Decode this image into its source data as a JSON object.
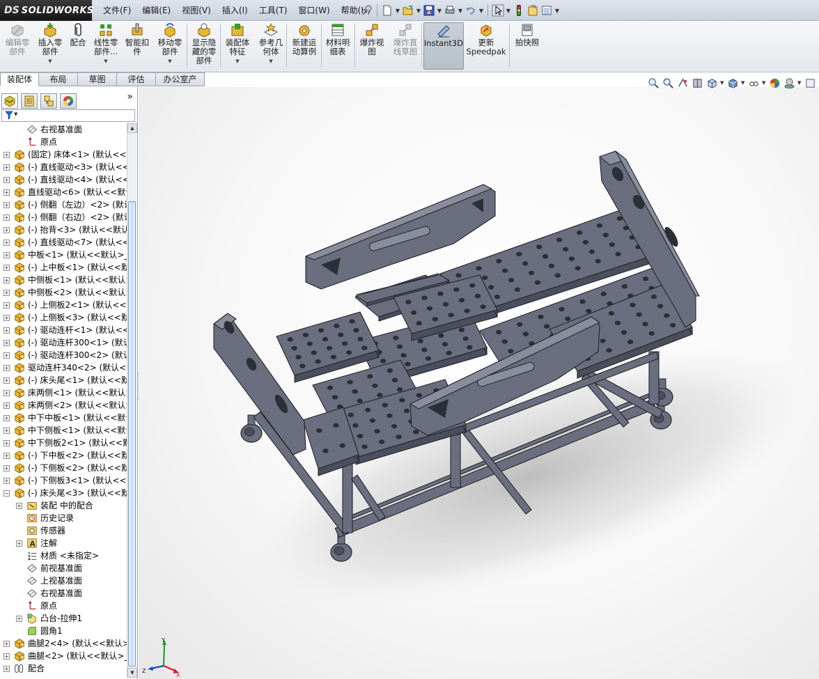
{
  "app": {
    "logo_prefix": "DS",
    "brand": "SOLIDWORKS"
  },
  "menu": [
    "文件(F)",
    "编辑(E)",
    "视图(V)",
    "插入(I)",
    "工具(T)",
    "窗口(W)",
    "帮助(H)"
  ],
  "quick_icons": [
    "pin-icon",
    "new-document-icon",
    "open-icon",
    "save-icon",
    "print-icon",
    "undo-icon",
    "select-cursor-icon",
    "rebuild-icon",
    "file-properties-icon",
    "options-icon"
  ],
  "commands": [
    {
      "label": "编辑零\n部件",
      "icon": "edit-component-icon",
      "disabled": true,
      "dropdown": false
    },
    {
      "label": "插入零\n部件",
      "icon": "insert-component-icon",
      "disabled": false,
      "dropdown": true
    },
    {
      "label": "配合",
      "icon": "mate-paperclip-icon",
      "disabled": false,
      "dropdown": false
    },
    {
      "label": "线性零\n部件...",
      "icon": "linear-pattern-icon",
      "disabled": false,
      "dropdown": true
    },
    {
      "label": "智能扣\n件",
      "icon": "smart-fasteners-icon",
      "disabled": false,
      "dropdown": false
    },
    {
      "label": "移动零\n部件",
      "icon": "move-component-icon",
      "disabled": false,
      "dropdown": true
    },
    {
      "label": "显示隐\n藏的零\n部件",
      "icon": "show-hidden-icon",
      "disabled": false,
      "dropdown": false
    },
    {
      "label": "装配体\n特征",
      "icon": "assembly-feature-icon",
      "disabled": false,
      "dropdown": true
    },
    {
      "label": "参考几\n何体",
      "icon": "reference-geometry-icon",
      "disabled": false,
      "dropdown": true
    },
    {
      "label": "新建运\n动算例",
      "icon": "new-motion-study-icon",
      "disabled": false,
      "dropdown": false
    },
    {
      "label": "材料明\n细表",
      "icon": "bill-of-materials-icon",
      "disabled": false,
      "dropdown": false
    },
    {
      "label": "爆炸视\n图",
      "icon": "exploded-view-icon",
      "disabled": false,
      "dropdown": false
    },
    {
      "label": "爆炸直\n线草图",
      "icon": "explode-line-sketch-icon",
      "disabled": true,
      "dropdown": false
    },
    {
      "label": "Instant3D",
      "icon": "instant3d-icon",
      "disabled": false,
      "dropdown": false,
      "active": true
    },
    {
      "label": "更新\nSpeedpak",
      "icon": "speedpak-icon",
      "disabled": false,
      "dropdown": false
    },
    {
      "label": "拍快照",
      "icon": "snapshot-icon",
      "disabled": false,
      "dropdown": false
    }
  ],
  "tabs": [
    "装配体",
    "布局",
    "草图",
    "评估",
    "办公室产品"
  ],
  "active_tab": "装配体",
  "panel_tabs": [
    "featuremanager-icon",
    "propertymanager-icon",
    "configurationmanager-icon",
    "appearance-icon"
  ],
  "panel_expand_glyph": "»",
  "filter_glyph": "▼",
  "tree": [
    {
      "label": "右视基准面",
      "icon": "plane-icon",
      "level": 1,
      "expander": ""
    },
    {
      "label": "原点",
      "icon": "origin-icon",
      "level": 1,
      "expander": ""
    },
    {
      "label": "(固定) 床体<1> (默认<<默",
      "icon": "part-icon",
      "level": 0,
      "expander": "+"
    },
    {
      "label": "(-) 直线驱动<3> (默认<<",
      "icon": "part-icon",
      "level": 0,
      "expander": "+"
    },
    {
      "label": "(-) 直线驱动<4> (默认<<",
      "icon": "part-icon",
      "level": 0,
      "expander": "+"
    },
    {
      "label": "直线驱动<6> (默认<<默认",
      "icon": "part-icon",
      "level": 0,
      "expander": "+"
    },
    {
      "label": "(-) 侧翻（左边）<2> (默认",
      "icon": "part-icon",
      "level": 0,
      "expander": "+"
    },
    {
      "label": "(-) 侧翻（右边）<2> (默认",
      "icon": "part-icon",
      "level": 0,
      "expander": "+"
    },
    {
      "label": "(-) 抬背<3> (默认<<默认",
      "icon": "part-icon",
      "level": 0,
      "expander": "+"
    },
    {
      "label": "(-) 直线驱动<7> (默认<<",
      "icon": "part-icon",
      "level": 0,
      "expander": "+"
    },
    {
      "label": "中板<1> (默认<<默认>_",
      "icon": "part-icon",
      "level": 0,
      "expander": "+"
    },
    {
      "label": "(-) 上中板<1> (默认<<默",
      "icon": "part-icon",
      "level": 0,
      "expander": "+"
    },
    {
      "label": "中侧板<1> (默认<<默认>",
      "icon": "part-icon",
      "level": 0,
      "expander": "+"
    },
    {
      "label": "中侧板<2> (默认<<默认>",
      "icon": "part-icon",
      "level": 0,
      "expander": "+"
    },
    {
      "label": "(-) 上侧板2<1> (默认<<默",
      "icon": "part-icon",
      "level": 0,
      "expander": "+"
    },
    {
      "label": "(-) 上侧板<3> (默认<<默",
      "icon": "part-icon",
      "level": 0,
      "expander": "+"
    },
    {
      "label": "(-) 驱动连杆<1> (默认<<",
      "icon": "part-icon",
      "level": 0,
      "expander": "+"
    },
    {
      "label": "(-) 驱动连杆300<1> (默认",
      "icon": "part-icon",
      "level": 0,
      "expander": "+"
    },
    {
      "label": "(-) 驱动连杆300<2> (默认",
      "icon": "part-icon",
      "level": 0,
      "expander": "+"
    },
    {
      "label": "驱动连杆340<2> (默认<<",
      "icon": "part-icon",
      "level": 0,
      "expander": "+"
    },
    {
      "label": "(-) 床头尾<1> (默认<<默",
      "icon": "part-icon",
      "level": 0,
      "expander": "+"
    },
    {
      "label": "床两侧<1> (默认<<默认>",
      "icon": "part-icon",
      "level": 0,
      "expander": "+"
    },
    {
      "label": "床两侧<2> (默认<<默认>",
      "icon": "part-icon",
      "level": 0,
      "expander": "+"
    },
    {
      "label": "中下中板<1> (默认<<默认",
      "icon": "part-icon",
      "level": 0,
      "expander": "+"
    },
    {
      "label": "中下侧板<1> (默认<<默认",
      "icon": "part-icon",
      "level": 0,
      "expander": "+"
    },
    {
      "label": "中下侧板2<1> (默认<<默",
      "icon": "part-icon",
      "level": 0,
      "expander": "+"
    },
    {
      "label": "(-) 下中板<2> (默认<<默",
      "icon": "part-icon",
      "level": 0,
      "expander": "+"
    },
    {
      "label": "(-) 下侧板<2> (默认<<默",
      "icon": "part-icon",
      "level": 0,
      "expander": "+"
    },
    {
      "label": "(-) 下侧板3<1> (默认<<默",
      "icon": "part-icon",
      "level": 0,
      "expander": "+"
    },
    {
      "label": "(-) 床头尾<3> (默认<<默",
      "icon": "part-icon",
      "level": 0,
      "expander": "-"
    },
    {
      "label": "装配 中的配合",
      "icon": "mates-folder-icon",
      "level": 1,
      "expander": "+"
    },
    {
      "label": "历史记录",
      "icon": "history-icon",
      "level": 1,
      "expander": ""
    },
    {
      "label": "传感器",
      "icon": "sensor-icon",
      "level": 1,
      "expander": ""
    },
    {
      "label": "注解",
      "icon": "annotation-icon",
      "level": 1,
      "expander": "+"
    },
    {
      "label": "材质 <未指定>",
      "icon": "material-icon",
      "level": 1,
      "expander": ""
    },
    {
      "label": "前视基准面",
      "icon": "plane-icon",
      "level": 1,
      "expander": ""
    },
    {
      "label": "上视基准面",
      "icon": "plane-icon",
      "level": 1,
      "expander": ""
    },
    {
      "label": "右视基准面",
      "icon": "plane-icon",
      "level": 1,
      "expander": ""
    },
    {
      "label": "原点",
      "icon": "origin-icon",
      "level": 1,
      "expander": ""
    },
    {
      "label": "凸台-拉伸1",
      "icon": "extrude-icon",
      "level": 1,
      "expander": "+"
    },
    {
      "label": "圆角1",
      "icon": "fillet-icon",
      "level": 1,
      "expander": ""
    },
    {
      "label": "曲腿2<4> (默认<<默认>_",
      "icon": "part-icon",
      "level": 0,
      "expander": "+"
    },
    {
      "label": "曲腿<2> (默认<<默认>_",
      "icon": "part-icon",
      "level": 0,
      "expander": "+"
    },
    {
      "label": "配合",
      "icon": "mates-icon",
      "level": 0,
      "expander": "+"
    }
  ],
  "view_icons": [
    "zoom-to-fit-icon",
    "zoom-area-icon",
    "previous-view-icon",
    "section-view-icon",
    "view-orientation-icon",
    "display-style-icon",
    "hide-show-icon",
    "edit-appearance-icon",
    "scene-icon",
    "view-settings-icon"
  ],
  "triad": {
    "x": "X",
    "y": "Y",
    "z": "Z"
  },
  "colors": {
    "model": "#6b6e7e",
    "model_dark": "#4b4e5c",
    "model_light": "#8a8d9c",
    "hole": "#2d2f38",
    "viewport_bg": "#ffffff",
    "part_icon": "#e7b52c"
  }
}
